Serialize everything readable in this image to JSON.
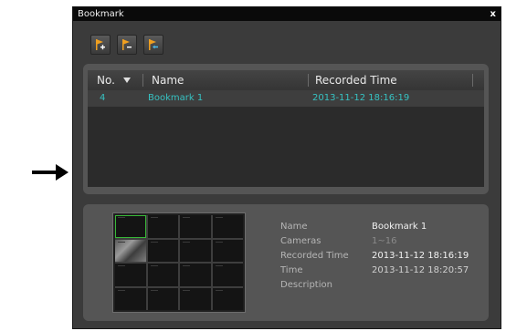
{
  "window": {
    "title": "Bookmark",
    "close_label": "x"
  },
  "toolbar": {
    "buttons": [
      {
        "icon": "flag-add-icon"
      },
      {
        "icon": "flag-remove-icon"
      },
      {
        "icon": "flag-return-icon"
      }
    ]
  },
  "list": {
    "headers": {
      "no": "No.",
      "name": "Name",
      "recorded_time": "Recorded Time"
    },
    "rows": [
      {
        "no": "4",
        "name": "Bookmark 1",
        "recorded_time": "2013-11-12  18:16:19"
      }
    ]
  },
  "details": {
    "labels": {
      "name": "Name",
      "cameras": "Cameras",
      "recorded_time": "Recorded Time",
      "time": "Time",
      "description": "Description"
    },
    "values": {
      "name": "Bookmark 1",
      "cameras": "1~16",
      "recorded_time": "2013-11-12  18:16:19",
      "time": "2013-11-12  18:20:57",
      "description": ""
    }
  },
  "colors": {
    "accent": "#36c2c2",
    "selection": "#38b838",
    "flag": "#f0a020"
  }
}
